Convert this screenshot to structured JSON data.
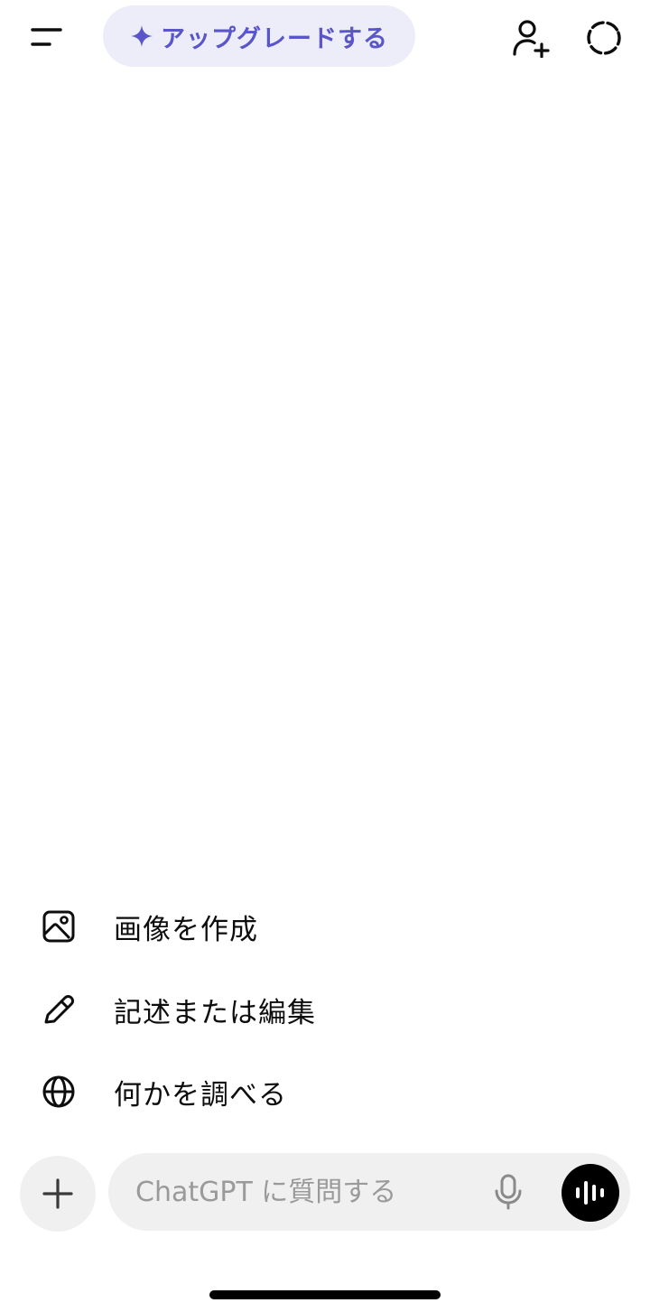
{
  "header": {
    "menu_icon": "sidebar-menu-icon",
    "upgrade_icon": "sparkle-icon",
    "upgrade_label": "アップグレードする",
    "add_user_icon": "add-user-icon",
    "temporary_chat_icon": "dashed-circle-icon",
    "accent_color": "#5a55c9",
    "upgrade_background": "#ecedf9"
  },
  "suggestions": [
    {
      "icon": "image-icon",
      "label": "画像を作成"
    },
    {
      "icon": "pencil-icon",
      "label": "記述または編集"
    },
    {
      "icon": "globe-icon",
      "label": "何かを調べる"
    }
  ],
  "composer": {
    "plus_icon": "plus-icon",
    "placeholder": "ChatGPT に質問する",
    "value": "",
    "mic_icon": "microphone-icon",
    "voice_icon": "voice-mode-icon"
  }
}
